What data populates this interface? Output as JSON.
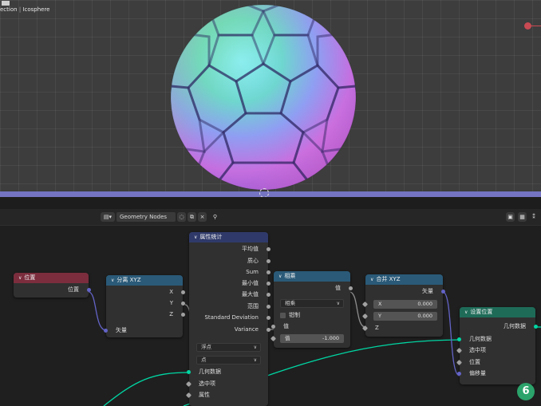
{
  "viewport": {
    "collection_label": "ection",
    "object_name": "Icosphere"
  },
  "editor_header": {
    "editor_type_icon": "node-editor-icon",
    "tree_name": "Geometry Nodes",
    "shield_icon": "fake-user-icon",
    "copy_icon": "duplicate-icon",
    "close_icon": "close-icon",
    "pin_icon": "pin-icon"
  },
  "nodes": {
    "position": {
      "title": "位置",
      "output": "位置",
      "color": "#7b2d3d"
    },
    "separate_xyz": {
      "title": "分离 XYZ",
      "outputs": [
        "X",
        "Y",
        "Z"
      ],
      "input": "矢量",
      "color": "#2a5a78"
    },
    "attribute_statistic": {
      "title": "属性统计",
      "outputs": [
        "平均值",
        "质心",
        "Sum",
        "最小值",
        "最大值",
        "范围",
        "Standard Deviation",
        "Variance"
      ],
      "domain_type": "浮点",
      "domain": "点",
      "inputs": [
        "几何数据",
        "选中项",
        "属性"
      ],
      "color": "#2f3a6a"
    },
    "map_range": {
      "title": "相乘",
      "output": "值",
      "operation": "相乘",
      "clamp_label": "钳制",
      "input_label": "值",
      "field_label": "值",
      "field_value": "-1.000",
      "color": "#2a5a78"
    },
    "combine_xyz": {
      "title": "合并 XYZ",
      "output": "矢量",
      "x_label": "X",
      "x_value": "0.000",
      "y_label": "Y",
      "y_value": "0.000",
      "z_label": "Z",
      "color": "#2a5a78"
    },
    "set_position": {
      "title": "设置位置",
      "output": "几何数据",
      "inputs": [
        "几何数据",
        "选中项",
        "位置",
        "偏移量"
      ],
      "color": "#1e6b58"
    }
  },
  "badge": "6",
  "colors": {
    "geometry_socket": "#00d6a3",
    "vector_socket": "#6363c7",
    "float_socket": "#a1a1a1"
  }
}
